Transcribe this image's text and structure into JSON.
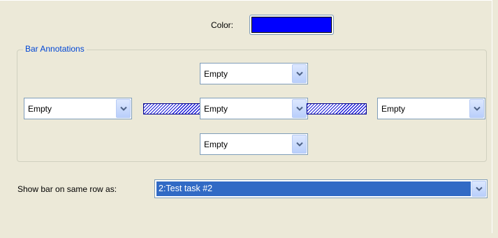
{
  "color": {
    "label": "Color:",
    "value": "#0000ff"
  },
  "bar_annotations": {
    "legend": "Bar Annotations",
    "top": "Empty",
    "left": "Empty",
    "center": "Empty",
    "right": "Empty",
    "bottom": "Empty",
    "hatch_color": "#1a1ad8"
  },
  "show_bar": {
    "label": "Show bar on same row as:",
    "value": "2:Test task #2"
  },
  "icons": {
    "dropdown": "chevron-down-icon"
  }
}
